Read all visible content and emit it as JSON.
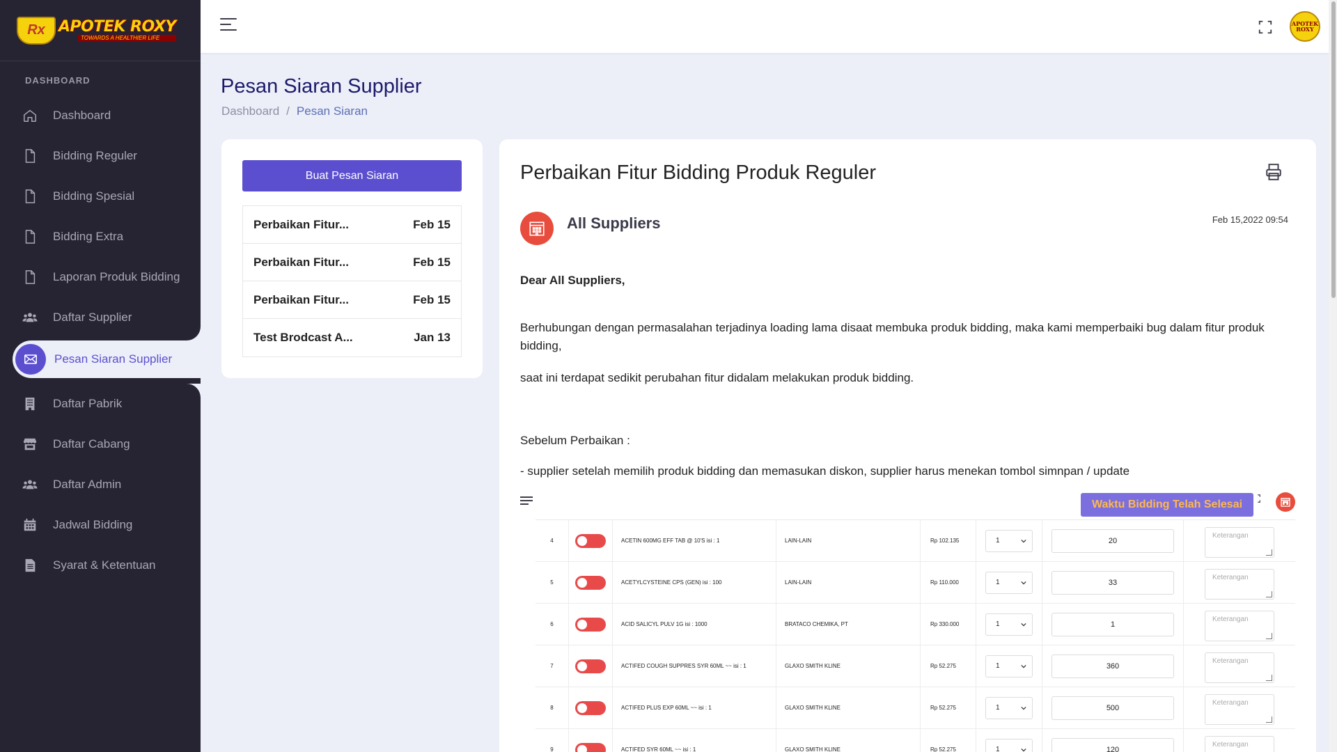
{
  "brand": {
    "logo_text": "APOTEK ROXY",
    "logo_sub": "TOWARDS A HEALTHIER LIFE",
    "logo_rx": "Rx"
  },
  "sidebar": {
    "section_label": "DASHBOARD",
    "items": [
      {
        "label": "Dashboard",
        "icon": "home-icon"
      },
      {
        "label": "Bidding Reguler",
        "icon": "file-icon"
      },
      {
        "label": "Bidding Spesial",
        "icon": "file-icon"
      },
      {
        "label": "Bidding Extra",
        "icon": "file-icon"
      },
      {
        "label": "Laporan Produk Bidding",
        "icon": "file-icon"
      },
      {
        "label": "Daftar Supplier",
        "icon": "users-icon"
      },
      {
        "label": "Pesan Siaran Supplier",
        "icon": "mail-icon",
        "active": true
      },
      {
        "label": "Daftar Pabrik",
        "icon": "building-icon"
      },
      {
        "label": "Daftar Cabang",
        "icon": "store-icon"
      },
      {
        "label": "Daftar Admin",
        "icon": "users-icon"
      },
      {
        "label": "Jadwal Bidding",
        "icon": "calendar-icon"
      },
      {
        "label": "Syarat & Ketentuan",
        "icon": "document-icon"
      }
    ]
  },
  "header": {
    "avatar_text_1": "APOTEK",
    "avatar_text_2": "ROXY"
  },
  "page": {
    "title": "Pesan Siaran Supplier",
    "breadcrumb": [
      "Dashboard",
      "Pesan Siaran"
    ],
    "separator": "/"
  },
  "list": {
    "create_button": "Buat Pesan Siaran",
    "messages": [
      {
        "title": "Perbaikan Fitur...",
        "date": "Feb 15"
      },
      {
        "title": "Perbaikan Fitur...",
        "date": "Feb 15"
      },
      {
        "title": "Perbaikan Fitur...",
        "date": "Feb 15"
      },
      {
        "title": "Test Brodcast A...",
        "date": "Jan 13"
      }
    ]
  },
  "message": {
    "title": "Perbaikan Fitur Bidding Produk Reguler",
    "sender": "All Suppliers",
    "date": "Feb 15,2022 09:54",
    "greeting": "Dear All Suppliers,",
    "paragraph1": "Berhubungan dengan permasalahan terjadinya loading lama disaat membuka produk bidding, maka kami memperbaiki bug dalam fitur produk bidding,",
    "paragraph2": "saat ini terdapat sedikit perubahan fitur didalam melakukan produk bidding.",
    "before_label": "Sebelum Perbaikan :",
    "bullet1": "- supplier setelah memilih produk bidding dan memasukan diskon, supplier harus menekan tombol simnpan / update"
  },
  "embed": {
    "badge": "Waktu Bidding Telah Selesai",
    "note_placeholder": "Keterangan",
    "rows": [
      {
        "no": "4",
        "name": "ACETIN 600MG EFF TAB @ 10'S isi : 1",
        "supplier": "LAIN-LAIN",
        "price": "Rp 102.135",
        "select": "1",
        "qty": "20"
      },
      {
        "no": "5",
        "name": "ACETYLCYSTEINE CPS (GEN) isi : 100",
        "supplier": "LAIN-LAIN",
        "price": "Rp 110.000",
        "select": "1",
        "qty": "33"
      },
      {
        "no": "6",
        "name": "ACID SALICYL PULV 1G isi : 1000",
        "supplier": "BRATACO CHEMIKA, PT",
        "price": "Rp 330.000",
        "select": "1",
        "qty": "1"
      },
      {
        "no": "7",
        "name": "ACTIFED COUGH SUPPRES SYR 60ML ~~ isi : 1",
        "supplier": "GLAXO SMITH KLINE",
        "price": "Rp 52.275",
        "select": "1",
        "qty": "360"
      },
      {
        "no": "8",
        "name": "ACTIFED PLUS EXP 60ML ~~ isi : 1",
        "supplier": "GLAXO SMITH KLINE",
        "price": "Rp 52.275",
        "select": "1",
        "qty": "500"
      },
      {
        "no": "9",
        "name": "ACTIFED SYR 60ML ~~ isi : 1",
        "supplier": "GLAXO SMITH KLINE",
        "price": "Rp 52.275",
        "select": "1",
        "qty": "120"
      }
    ]
  },
  "colors": {
    "primary": "#5b4fcf",
    "sidebar": "#262433",
    "title": "#1c1a6b",
    "danger": "#e74c3c"
  }
}
